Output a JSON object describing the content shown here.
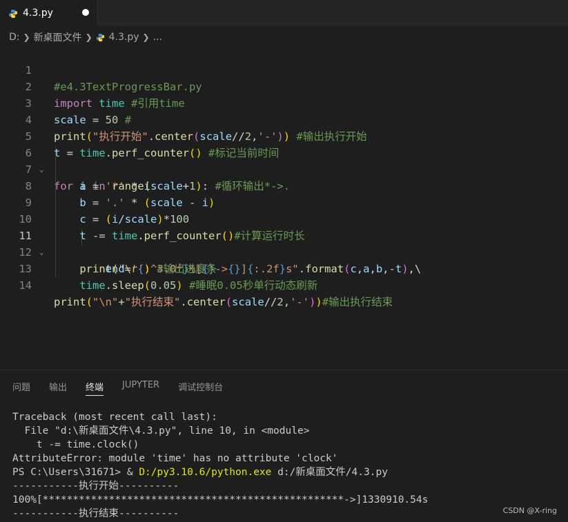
{
  "tab": {
    "filename": "4.3.py",
    "modified": true,
    "icon": "python-icon"
  },
  "breadcrumb": {
    "drive": "D:",
    "folder": "新桌面文件",
    "file": "4.3.py",
    "more": "..."
  },
  "editor": {
    "active_line": 11,
    "lines": [
      {
        "n": "1"
      },
      {
        "n": "2"
      },
      {
        "n": "3"
      },
      {
        "n": "4"
      },
      {
        "n": "5"
      },
      {
        "n": "6"
      },
      {
        "n": "7"
      },
      {
        "n": "8"
      },
      {
        "n": "9"
      },
      {
        "n": "10"
      },
      {
        "n": "11"
      },
      {
        "n": "12"
      },
      {
        "n": "13"
      },
      {
        "n": "14"
      }
    ],
    "code": {
      "l1": "#e4.3TextProgressBar.py",
      "l2_kw": "import",
      "l2_mod": "time",
      "l2_com": "#引用time",
      "l3_var": "scale",
      "l3_num": "50",
      "l3_com": "#",
      "l4_fn": "print",
      "l4_str": "\"执行开始\"",
      "l4_call": "center",
      "l4_var": "scale",
      "l4_num": "2",
      "l4_str2": "'-'",
      "l4_com": "#输出执行开始",
      "l5_var": "t",
      "l5_mod": "time",
      "l5_fn": "perf_counter",
      "l5_com": "#标记当前时间",
      "l6_kw": "for",
      "l6_var": "i",
      "l6_kw2": "in",
      "l6_fn": "range",
      "l6_var2": "scale",
      "l6_num": "1",
      "l6_com": "#循环输出*->.",
      "l7_var": "a",
      "l7_str": "'*'",
      "l7_var2": "i",
      "l8_var": "b",
      "l8_str": "'.'",
      "l8_var2": "scale",
      "l8_var3": "i",
      "l9_var": "c",
      "l9_var2": "i",
      "l9_var3": "scale",
      "l9_num": "100",
      "l10_var": "t",
      "l10_mod": "time",
      "l10_fn": "perf_counter",
      "l10_com": "#计算运行时长",
      "l11_fn": "print",
      "l11_call": "format",
      "l12_var": "end",
      "l12_str": "''",
      "l12_com": "#输出进度条",
      "l13_mod": "time",
      "l13_fn": "sleep",
      "l13_num": "0.05",
      "l13_com": "#睡眠0.05秒单行动态刷新",
      "l14_fn": "print",
      "l14_str": "\"\\n\"",
      "l14_str2": "\"执行结束\"",
      "l14_call": "center",
      "l14_var": "scale",
      "l14_num": "2",
      "l14_str3": "'-'",
      "l14_com": "#输出执行结束"
    }
  },
  "panel": {
    "tabs": [
      "问题",
      "输出",
      "终端",
      "JUPYTER",
      "调试控制台"
    ],
    "active_tab": "终端",
    "terminal": [
      "Traceback (most recent call last):",
      "  File \"d:\\新桌面文件\\4.3.py\", line 10, in <module>",
      "    t -= time.clock()",
      "AttributeError: module 'time' has no attribute 'clock'",
      "PS C:\\Users\\31671> & ",
      "D:/py3.10.6/python.exe",
      " d:/新桌面文件/4.3.py",
      "-----------执行开始----------",
      "100%[**************************************************->]1330910.54s",
      "-----------执行结束----------"
    ]
  },
  "watermark": "CSDN @X-ring"
}
